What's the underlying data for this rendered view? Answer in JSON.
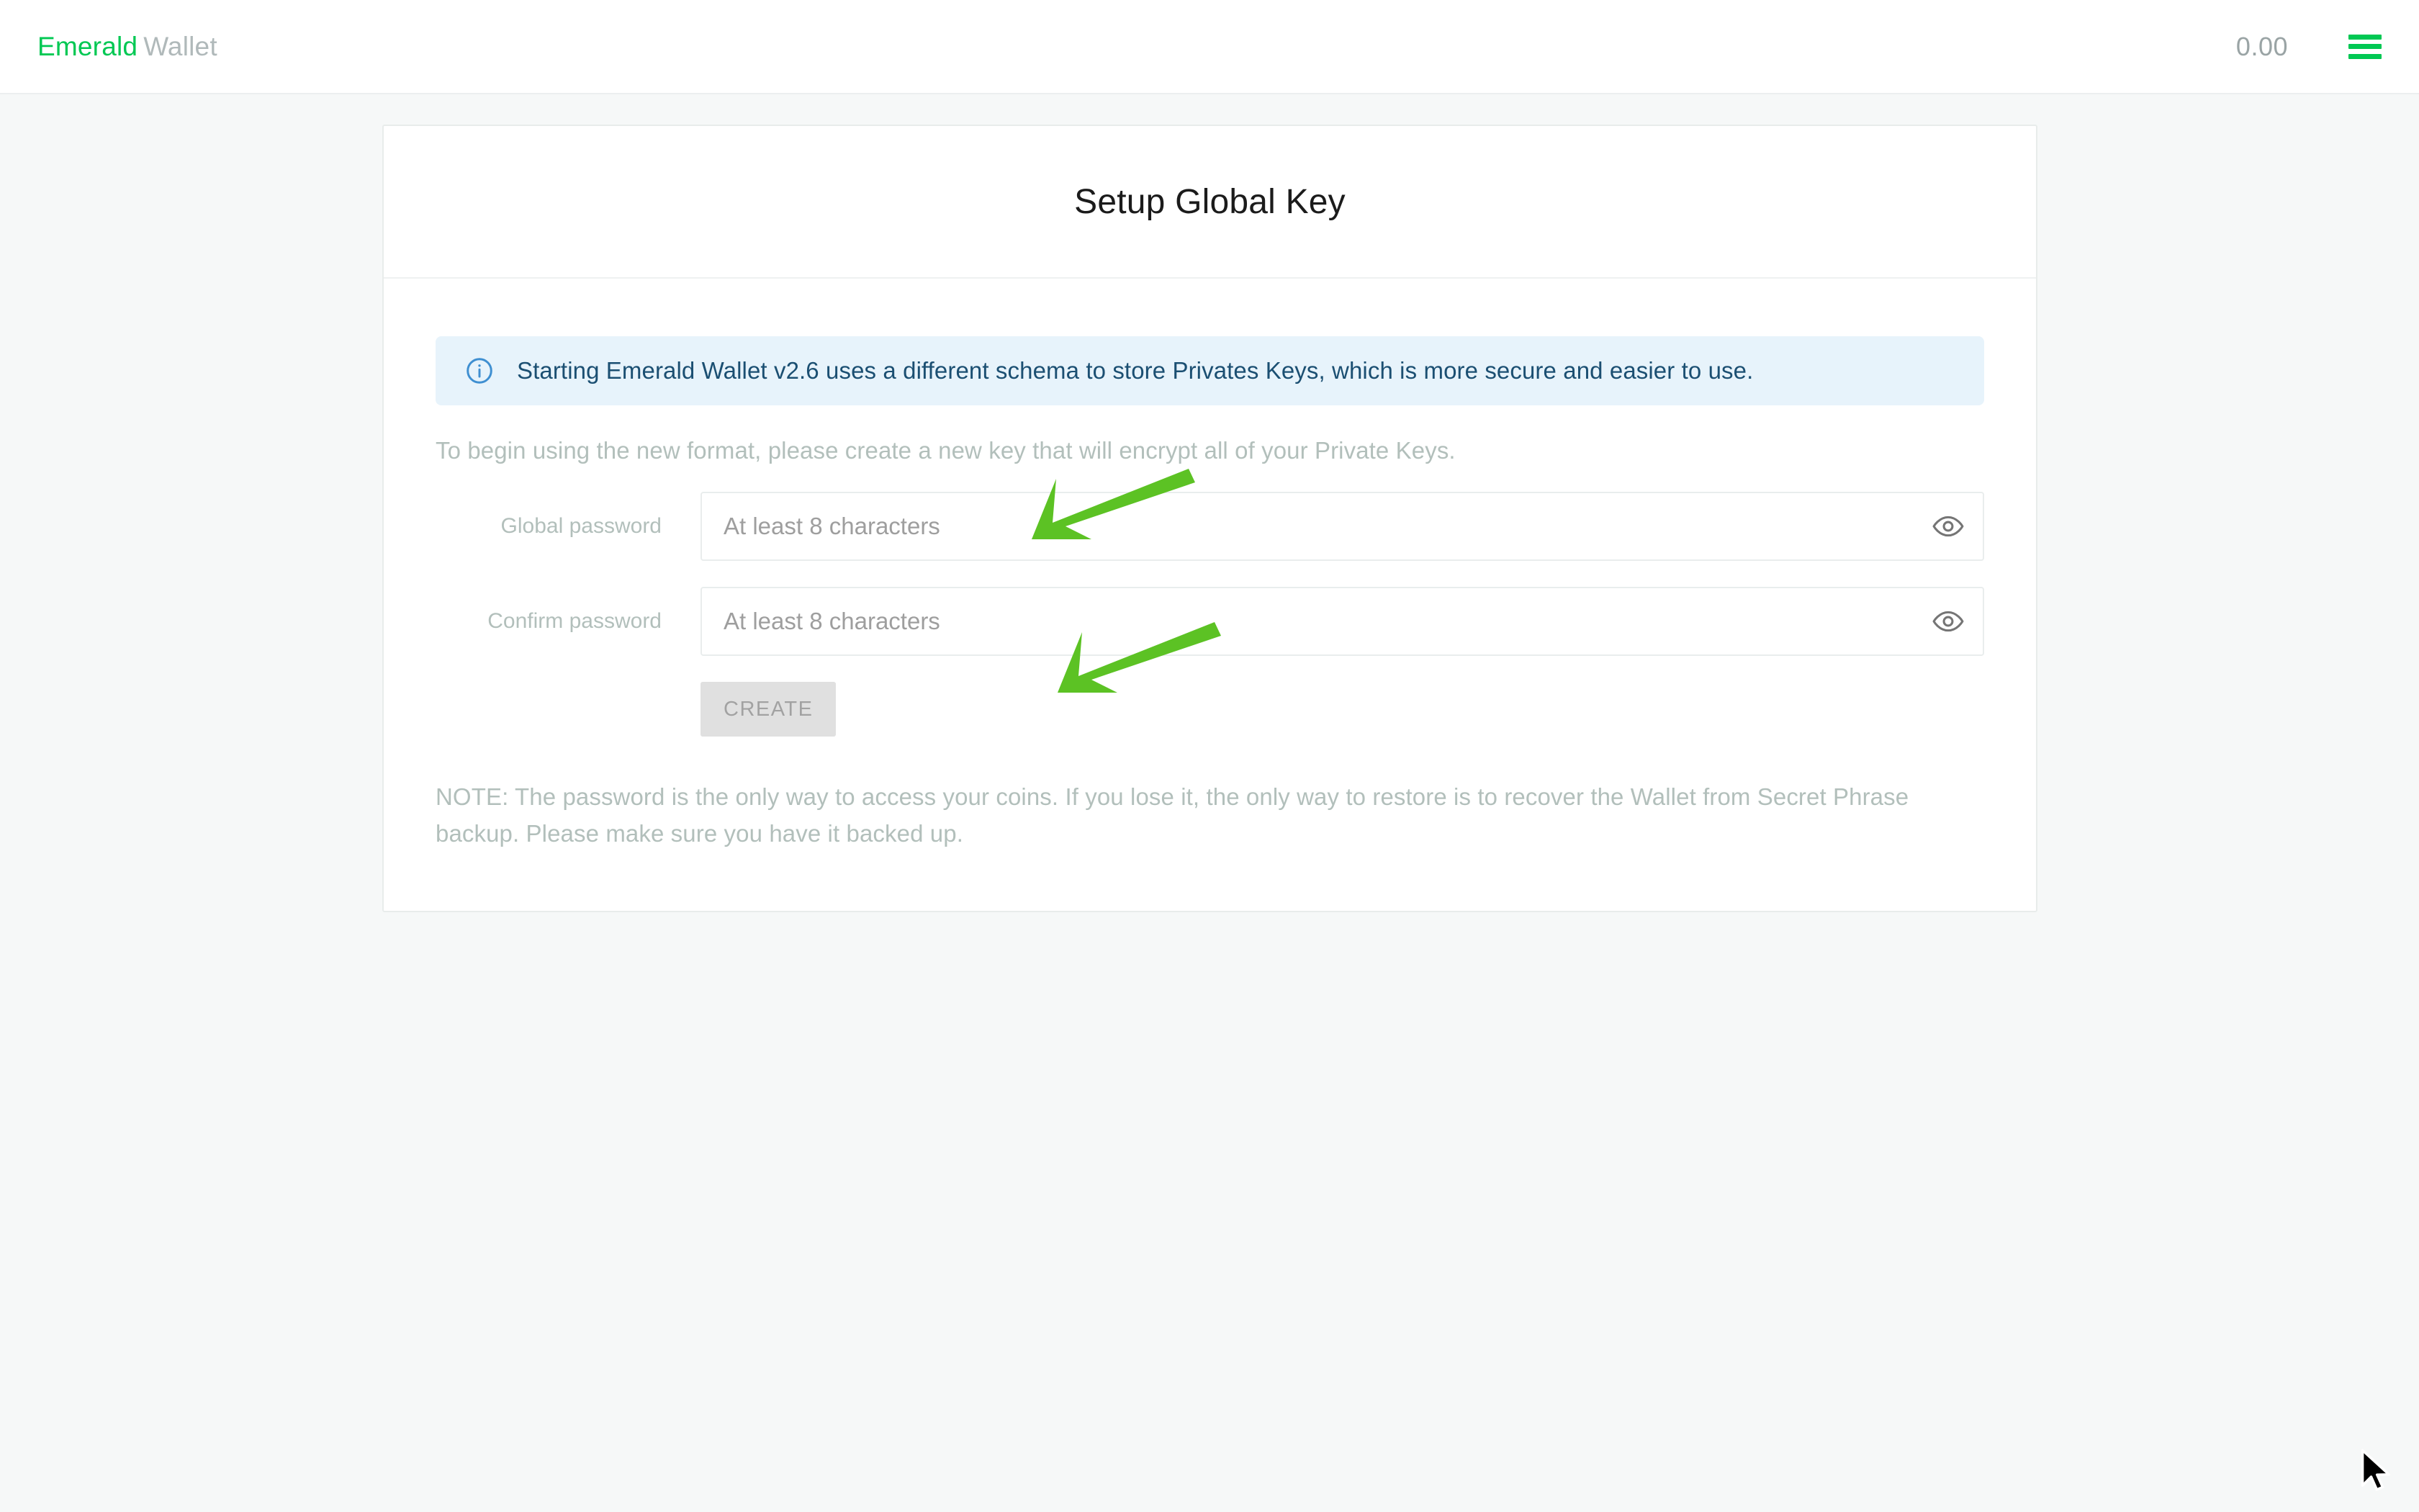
{
  "topbar": {
    "brand_primary": "Emerald",
    "brand_secondary": "Wallet",
    "balance": "0.00",
    "menu_icon": "hamburger-menu-icon"
  },
  "card": {
    "title": "Setup Global Key",
    "alert": {
      "icon": "info-circle-icon",
      "text": "Starting Emerald Wallet v2.6 uses a different schema to store Privates Keys, which is more secure and easier to use."
    },
    "intro": "To begin using the new format, please create a new key that will encrypt all of your Private Keys.",
    "fields": [
      {
        "label": "Global password",
        "placeholder": "At least 8 characters",
        "value": "",
        "reveal_icon": "eye-icon"
      },
      {
        "label": "Confirm password",
        "placeholder": "At least 8 characters",
        "value": "",
        "reveal_icon": "eye-icon"
      }
    ],
    "create_button": "CREATE",
    "note": "NOTE: The password is the only way to access your coins. If you lose it, the only way to restore is to recover the Wallet from Secret Phrase backup. Please make sure you have it backed up."
  },
  "colors": {
    "brand_green": "#00c853",
    "annotation_green": "#5cc224",
    "alert_bg": "#e7f3fb",
    "alert_text": "#1b4f72",
    "page_bg": "#f6f8f8",
    "muted_text": "#b2bfbb"
  },
  "annotations": [
    {
      "name": "arrow-to-global-password-field",
      "points_at": "Global password input"
    },
    {
      "name": "arrow-to-confirm-password-field",
      "points_at": "Confirm password input"
    }
  ]
}
